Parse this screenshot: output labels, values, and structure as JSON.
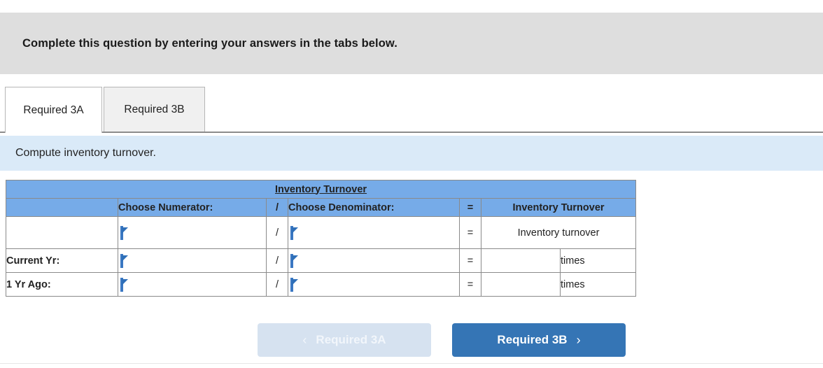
{
  "instruction": {
    "text": "Complete this question by entering your answers in the tabs below."
  },
  "tabs": [
    {
      "label": "Required 3A",
      "active": true
    },
    {
      "label": "Required 3B",
      "active": false
    }
  ],
  "info_bar": {
    "text": "Compute inventory turnover."
  },
  "table": {
    "title": "Inventory Turnover",
    "headers": {
      "row_label": "",
      "numerator": "Choose Numerator:",
      "divide": "/",
      "denominator": "Choose Denominator:",
      "equals": "=",
      "result": "Inventory Turnover"
    },
    "rows": [
      {
        "label": "",
        "numerator_value": "",
        "operator": "/",
        "denominator_value": "",
        "equals": "=",
        "result": "Inventory turnover",
        "unit": ""
      },
      {
        "label": "Current Yr:",
        "numerator_value": "",
        "operator": "/",
        "denominator_value": "",
        "equals": "=",
        "result": "",
        "unit": "times"
      },
      {
        "label": "1 Yr Ago:",
        "numerator_value": "",
        "operator": "/",
        "denominator_value": "",
        "equals": "=",
        "result": "",
        "unit": "times"
      }
    ]
  },
  "nav": {
    "prev_label": "Required 3A",
    "prev_icon": "chevron-left-icon",
    "prev_chevron": "‹",
    "next_label": "Required 3B",
    "next_icon": "chevron-right-icon",
    "next_chevron": "›"
  },
  "colors": {
    "banner_gray": "#dedede",
    "info_blue": "#daeaf8",
    "table_header_blue": "#76abe8",
    "title_navy": "#16365c",
    "dropdown_border": "#3b78c3",
    "btn_active_blue": "#3575b5",
    "btn_disabled_blue": "#d6e2f0"
  }
}
